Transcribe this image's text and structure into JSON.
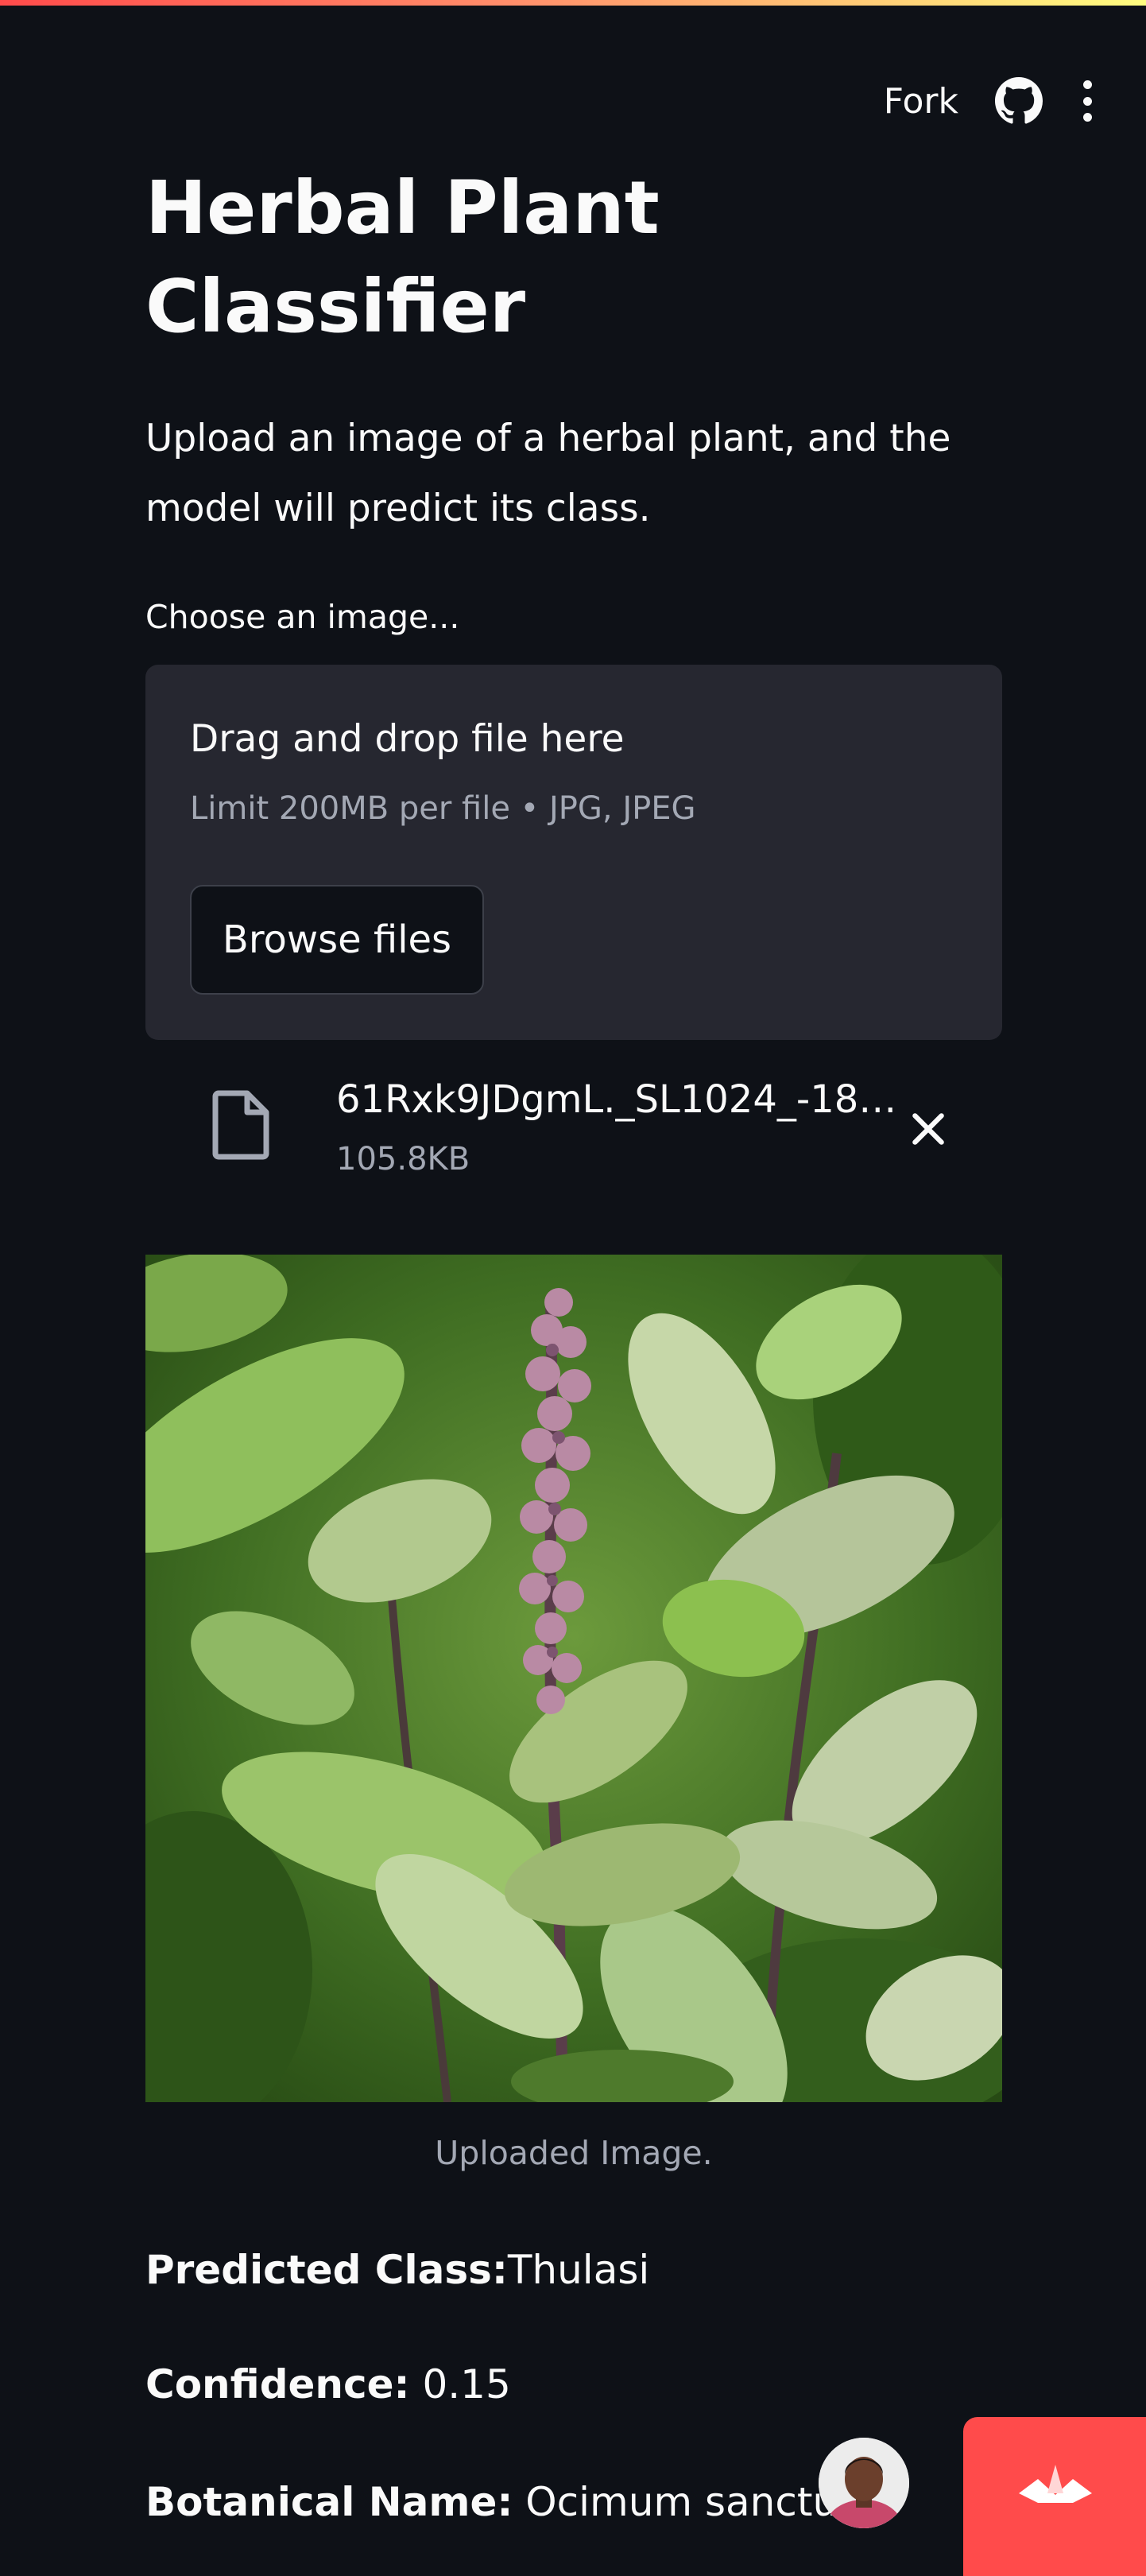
{
  "header": {
    "fork_label": "Fork",
    "github_icon": "github-icon",
    "menu_icon": "kebab-menu-icon",
    "accent_gradient": [
      "#ff4b4b",
      "#fffd80"
    ]
  },
  "page": {
    "title": "Herbal Plant Classifier",
    "subtitle": "Upload an image of a herbal plant, and the model will predict its class."
  },
  "uploader": {
    "label": "Choose an image...",
    "drop_title": "Drag and drop file here",
    "limit_text": "Limit 200MB per file • JPG, JPEG",
    "browse_label": "Browse files"
  },
  "file": {
    "name": "61Rxk9JDgmL._SL1024_-18…",
    "size": "105.8KB",
    "icon": "file-icon",
    "remove_icon": "close-icon"
  },
  "image": {
    "caption": "Uploaded Image."
  },
  "results": {
    "predicted_label": "Predicted Class:",
    "predicted_value": "Thulasi",
    "confidence_label": "Confidence:",
    "confidence_value": " 0.15",
    "botanical_label": "Botanical Name:",
    "botanical_value": " Ocimum sanctum"
  },
  "colors": {
    "background": "#0e1117",
    "dropzone": "#262730",
    "badge": "#ff4b4b"
  }
}
